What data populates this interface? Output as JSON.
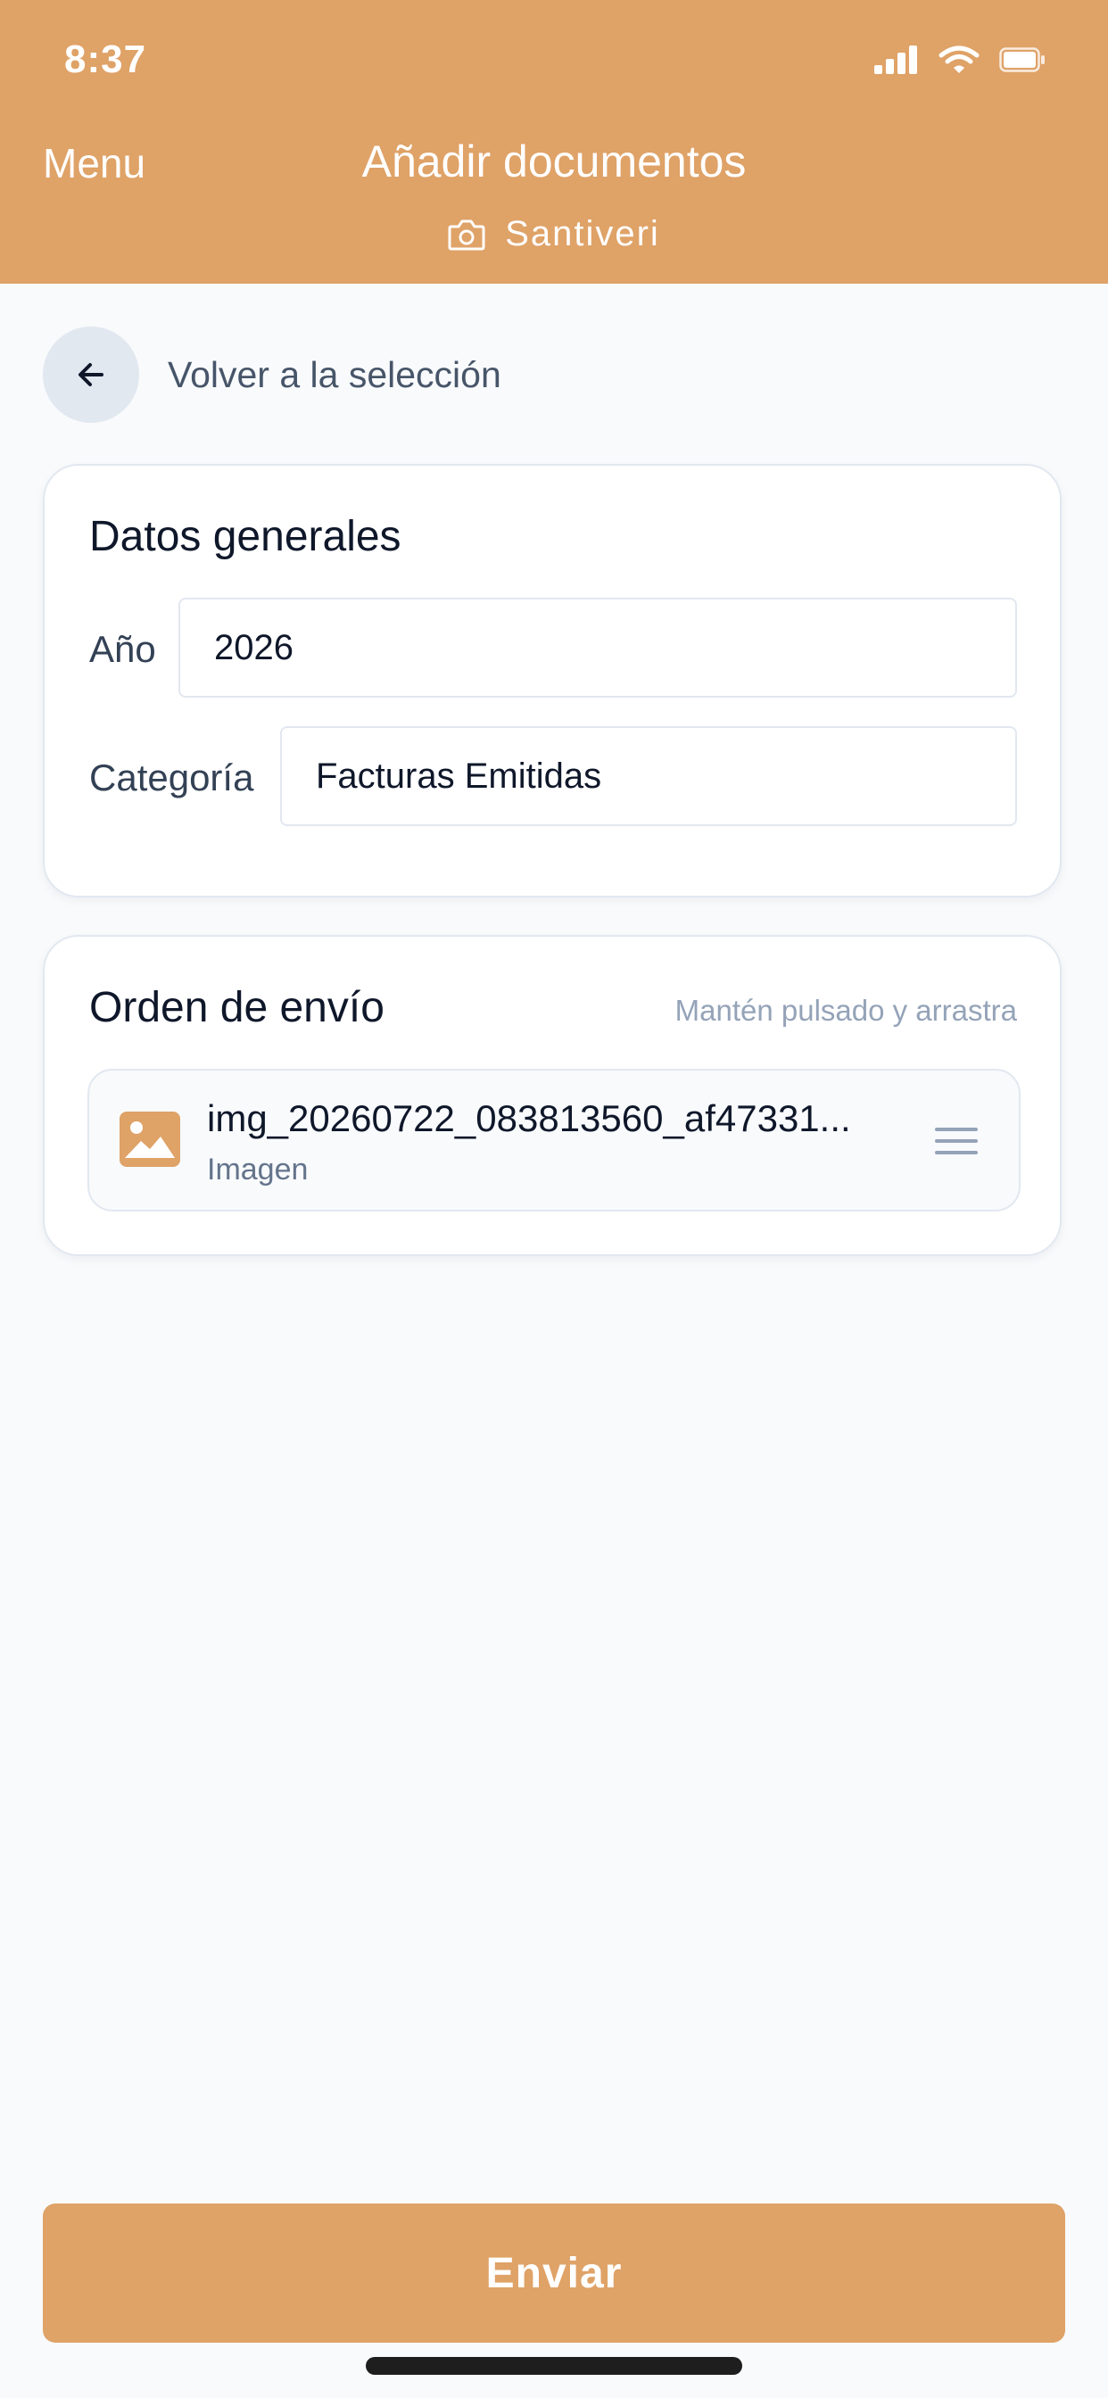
{
  "status_bar": {
    "time": "8:37",
    "icons": [
      "signal-icon",
      "wifi-icon",
      "battery-icon"
    ]
  },
  "header": {
    "menu_label": "Menu",
    "title": "Añadir documentos",
    "company": "Santiveri",
    "company_icon": "camera-icon"
  },
  "back": {
    "label": "Volver a la selección",
    "icon": "arrow-left-icon"
  },
  "general": {
    "title": "Datos generales",
    "year_label": "Año",
    "year_value": "2026",
    "category_label": "Categoría",
    "category_value": "Facturas Emitidas"
  },
  "order": {
    "title": "Orden de envío",
    "hint": "Mantén pulsado y arrastra",
    "items": [
      {
        "name": "img_20260722_083813560_af47331...",
        "type": "Imagen",
        "icon": "image-icon",
        "handle_icon": "drag-handle-icon"
      }
    ]
  },
  "send_label": "Enviar",
  "colors": {
    "accent": "#DFA267",
    "background": "#F8FAFC",
    "text_primary": "#0F172A",
    "text_secondary": "#64748B"
  }
}
